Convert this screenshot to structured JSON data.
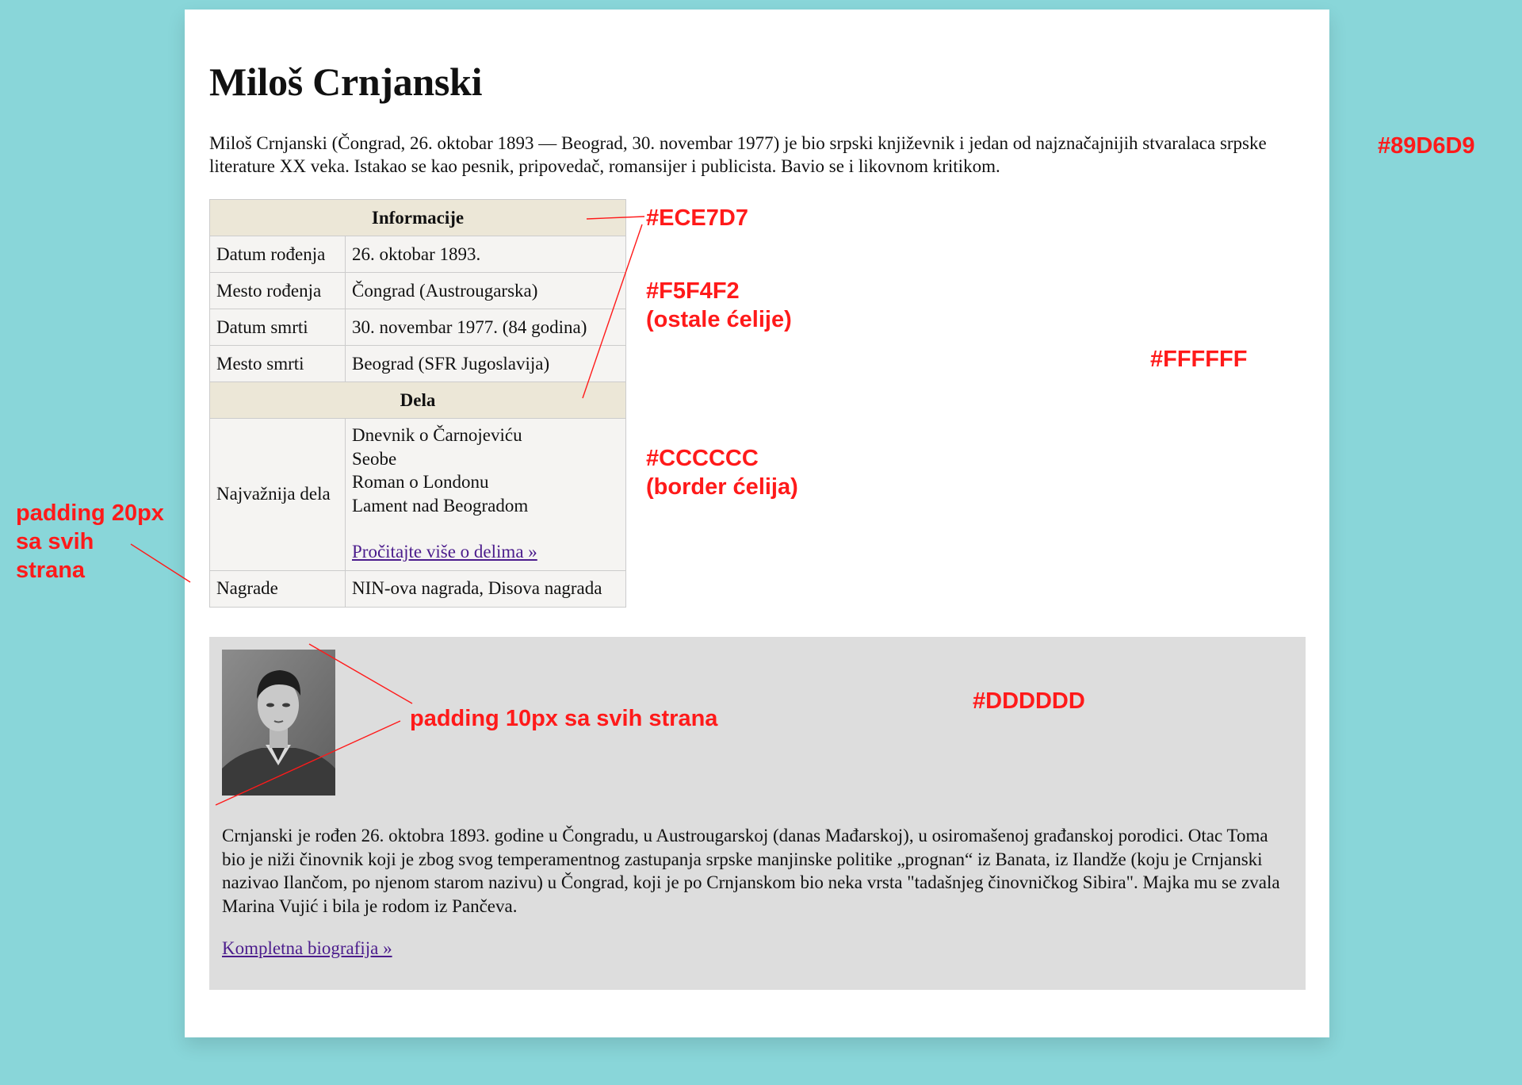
{
  "page": {
    "title": "Miloš Crnjanski",
    "intro": "Miloš Crnjanski (Čongrad, 26. oktobar 1893 — Beograd, 30. novembar 1977) je bio srpski književnik i jedan od najznačajnijih stvaralaca srpske literature XX veka. Istakao se kao pesnik, pripovedač, romansijer i publicista. Bavio se i likovnom kritikom."
  },
  "info_table": {
    "section_info": "Informacije",
    "rows": [
      {
        "label": "Datum rođenja",
        "value": "26. oktobar 1893."
      },
      {
        "label": "Mesto rođenja",
        "value": "Čongrad (Austrougarska)"
      },
      {
        "label": "Datum smrti",
        "value": "30. novembar 1977. (84 godina)"
      },
      {
        "label": "Mesto smrti",
        "value": "Beograd (SFR Jugoslavija)"
      }
    ],
    "section_works": "Dela",
    "works_label": "Najvažnija dela",
    "works": [
      "Dnevnik o Čarnojeviću",
      "Seobe",
      "Roman o Londonu",
      "Lament nad Beogradom"
    ],
    "works_link": "Pročitajte više o delima »",
    "awards_label": "Nagrade",
    "awards_value": "NIN-ova nagrada, Disova nagrada"
  },
  "bio": {
    "text": "Crnjanski je rođen 26. oktobra 1893. godine u Čongradu, u Austrougarskoj (danas Mađarskoj), u osiromašenoj građanskoj porodici. Otac Toma bio je niži činovnik koji je zbog svog temperamentnog zastupanja srpske manjinske politike „prognan“ iz Banata, iz Ilandže (koju je Crnjanski nazivao Ilančom, po njenom starom nazivu) u Čongrad, koji je po Crnjanskom bio neka vrsta \"tadašnjeg činovničkog Sibira\". Majka mu se zvala Marina Vujić i bila je rodom iz Pančeva.",
    "link": "Kompletna biografija »"
  },
  "annotations": {
    "outer_bg": "#89D6D9",
    "header_bg": "#ECE7D7",
    "cell_bg": "#F5F4F2",
    "cell_bg_note": "(ostale ćelije)",
    "page_bg": "#FFFFFF",
    "border": "#CCCCCC",
    "border_note": "(border ćelija)",
    "bio_bg": "#DDDDDD",
    "outer_padding": [
      "padding 20px",
      "sa svih",
      "strana"
    ],
    "inner_padding": "padding 10px sa svih strana"
  }
}
